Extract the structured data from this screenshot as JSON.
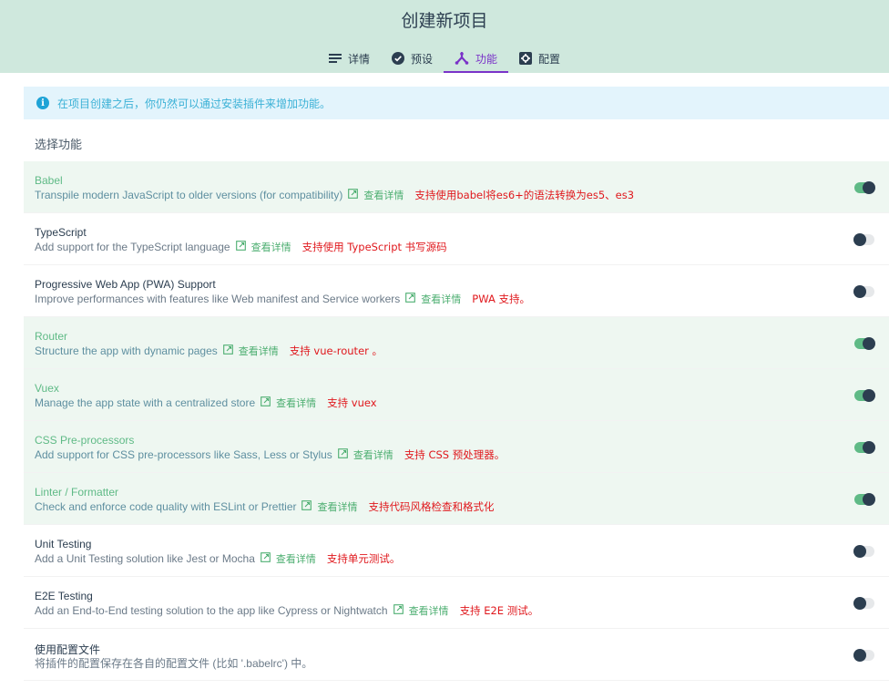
{
  "header": {
    "title": "创建新项目",
    "tabs": [
      {
        "label": "详情",
        "icon": "list-icon",
        "active": false
      },
      {
        "label": "预设",
        "icon": "check-circle-icon",
        "active": false
      },
      {
        "label": "功能",
        "icon": "fork-icon",
        "active": true
      },
      {
        "label": "配置",
        "icon": "settings-box-icon",
        "active": false
      }
    ]
  },
  "notice": {
    "text": "在项目创建之后，你仍然可以通过安装插件来增加功能。",
    "icon": "info-icon"
  },
  "section_title": "选择功能",
  "detail_link_label": "查看详情",
  "colors": {
    "header_bg": "#cfe8dd",
    "accent": "#7a32c8",
    "enabled_green": "#5fba86",
    "annotation_red": "#e0181d",
    "notice_bg": "#e3f4fc",
    "notice_text": "#3bb1d6"
  },
  "features": [
    {
      "name": "Babel",
      "desc": "Transpile modern JavaScript to older versions (for compatibility)",
      "has_link": true,
      "annotation": "支持使用babel将es6+的语法转换为es5、es3",
      "enabled": true
    },
    {
      "name": "TypeScript",
      "desc": "Add support for the TypeScript language",
      "has_link": true,
      "annotation": "支持使用 TypeScript 书写源码",
      "enabled": false
    },
    {
      "name": "Progressive Web App (PWA) Support",
      "desc": "Improve performances with features like Web manifest and Service workers",
      "has_link": true,
      "annotation": "PWA 支持。",
      "enabled": false
    },
    {
      "name": "Router",
      "desc": "Structure the app with dynamic pages",
      "has_link": true,
      "annotation": "支持 vue-router 。",
      "enabled": true
    },
    {
      "name": "Vuex",
      "desc": "Manage the app state with a centralized store",
      "has_link": true,
      "annotation": "支持 vuex",
      "enabled": true
    },
    {
      "name": "CSS Pre-processors",
      "desc": "Add support for CSS pre-processors like Sass, Less or Stylus",
      "has_link": true,
      "annotation": "支持 CSS 预处理器。",
      "enabled": true
    },
    {
      "name": "Linter / Formatter",
      "desc": "Check and enforce code quality with ESLint or Prettier",
      "has_link": true,
      "annotation": "支持代码风格检查和格式化",
      "enabled": true
    },
    {
      "name": "Unit Testing",
      "desc": "Add a Unit Testing solution like Jest or Mocha",
      "has_link": true,
      "annotation": "支持单元测试。",
      "enabled": false
    },
    {
      "name": "E2E Testing",
      "desc": "Add an End-to-End testing solution to the app like Cypress or Nightwatch",
      "has_link": true,
      "annotation": "支持 E2E 测试。",
      "enabled": false
    },
    {
      "name": "使用配置文件",
      "desc": "将插件的配置保存在各自的配置文件 (比如 '.babelrc') 中。",
      "has_link": false,
      "annotation": "",
      "enabled": false
    }
  ]
}
